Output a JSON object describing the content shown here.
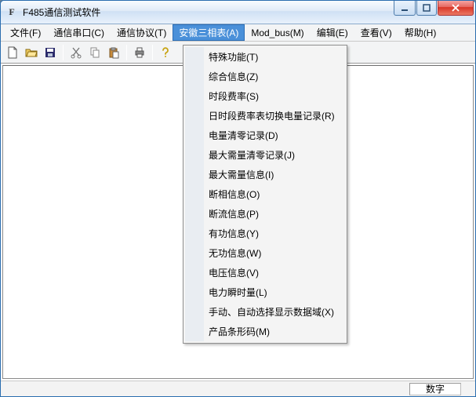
{
  "window": {
    "title": "F485通信测试软件",
    "app_letter": "F"
  },
  "menubar": {
    "items": [
      {
        "label": "文件(F)",
        "open": false
      },
      {
        "label": "通信串口(C)",
        "open": false
      },
      {
        "label": "通信协议(T)",
        "open": false
      },
      {
        "label": "安徽三相表(A)",
        "open": true
      },
      {
        "label": "Mod_bus(M)",
        "open": false
      },
      {
        "label": "编辑(E)",
        "open": false
      },
      {
        "label": "查看(V)",
        "open": false
      },
      {
        "label": "帮助(H)",
        "open": false
      }
    ]
  },
  "toolbar_icons": [
    "new-icon",
    "open-icon",
    "save-icon",
    "__sep__",
    "cut-icon",
    "copy-icon",
    "paste-icon",
    "__sep__",
    "print-icon",
    "__sep__",
    "help-icon"
  ],
  "dropdown": {
    "items": [
      {
        "label": "特殊功能(T)"
      },
      {
        "label": "综合信息(Z)"
      },
      {
        "label": "时段费率(S)"
      },
      {
        "label": "日时段费率表切换电量记录(R)"
      },
      {
        "label": "电量清零记录(D)"
      },
      {
        "label": "最大需量清零记录(J)"
      },
      {
        "label": "最大需量信息(I)"
      },
      {
        "label": "断相信息(O)"
      },
      {
        "label": "断流信息(P)"
      },
      {
        "label": "有功信息(Y)"
      },
      {
        "label": "无功信息(W)"
      },
      {
        "label": "电压信息(V)"
      },
      {
        "label": "电力瞬时量(L)"
      },
      {
        "label": "手动、自动选择显示数据域(X)"
      },
      {
        "label": "产品条形码(M)"
      }
    ]
  },
  "statusbar": {
    "num": "数字"
  }
}
